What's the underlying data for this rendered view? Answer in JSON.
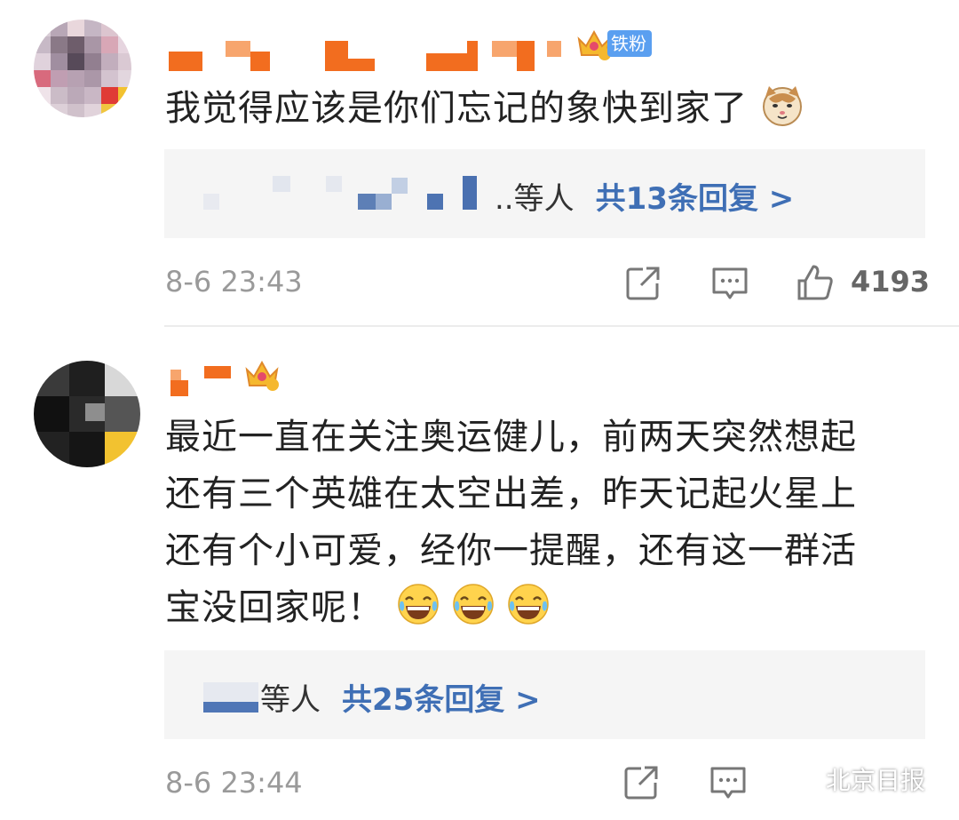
{
  "comments": [
    {
      "badge_label": "铁粉",
      "crown_level": "6",
      "text": "我觉得应该是你们忘记的象快到家了",
      "replies": {
        "suffix": "..等人",
        "count_label": "共13条回复 >"
      },
      "time": "8-6 23:43",
      "likes": "4193",
      "icons": [
        "share-icon",
        "comment-icon",
        "like-icon"
      ]
    },
    {
      "crown_level": "6",
      "text_lines": [
        "最近一直在关注奥运健儿，前两天突然想起",
        "还有三个英雄在太空出差，昨天记起火星上",
        "还有个小可爱，经你一提醒，还有这一群活",
        "宝没回家呢！"
      ],
      "emojis": [
        "laugh-cry-emoji",
        "laugh-cry-emoji",
        "laugh-cry-emoji"
      ],
      "replies": {
        "suffix": "等人",
        "count_label": "共25条回复 >"
      },
      "time": "8-6 23:44",
      "icons": [
        "share-icon",
        "comment-icon",
        "like-icon"
      ]
    }
  ],
  "watermark": {
    "label": "北京日报",
    "icon": "wechat-icon"
  },
  "colors": {
    "link": "#3f6fb5",
    "name_blur": "#f26d1f",
    "badge": "#5a9ff0",
    "reply_bg": "#f5f5f5"
  }
}
